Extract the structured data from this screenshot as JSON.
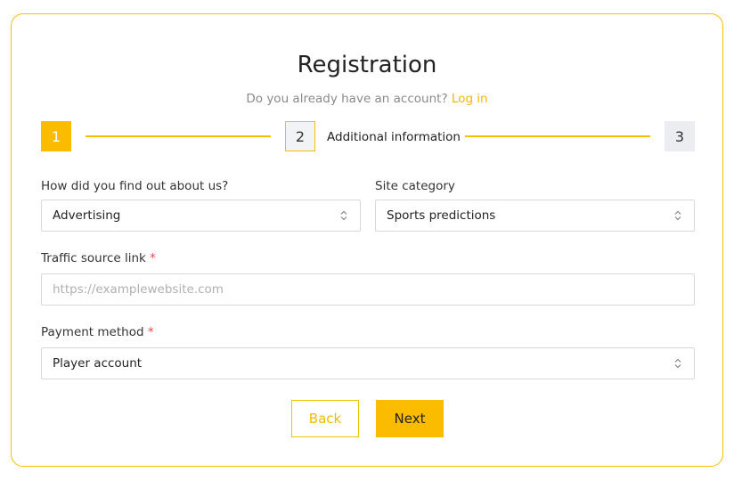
{
  "header": {
    "title": "Registration",
    "account_prompt": "Do you already have an account?",
    "login_link": "Log in"
  },
  "stepper": {
    "steps": [
      {
        "number": "1",
        "state": "completed"
      },
      {
        "number": "2",
        "label": "Additional information",
        "state": "current"
      },
      {
        "number": "3",
        "state": "pending"
      }
    ]
  },
  "form": {
    "referral": {
      "label": "How did you find out about us?",
      "value": "Advertising"
    },
    "site_category": {
      "label": "Site category",
      "value": "Sports predictions"
    },
    "traffic_source": {
      "label": "Traffic source link",
      "required_mark": "*",
      "placeholder": "https://examplewebsite.com",
      "value": ""
    },
    "payment_method": {
      "label": "Payment method",
      "required_mark": "*",
      "value": "Player account"
    }
  },
  "actions": {
    "back_label": "Back",
    "next_label": "Next"
  },
  "colors": {
    "accent": "#fbbc00",
    "border": "#f2c200",
    "required": "#e5484d"
  }
}
